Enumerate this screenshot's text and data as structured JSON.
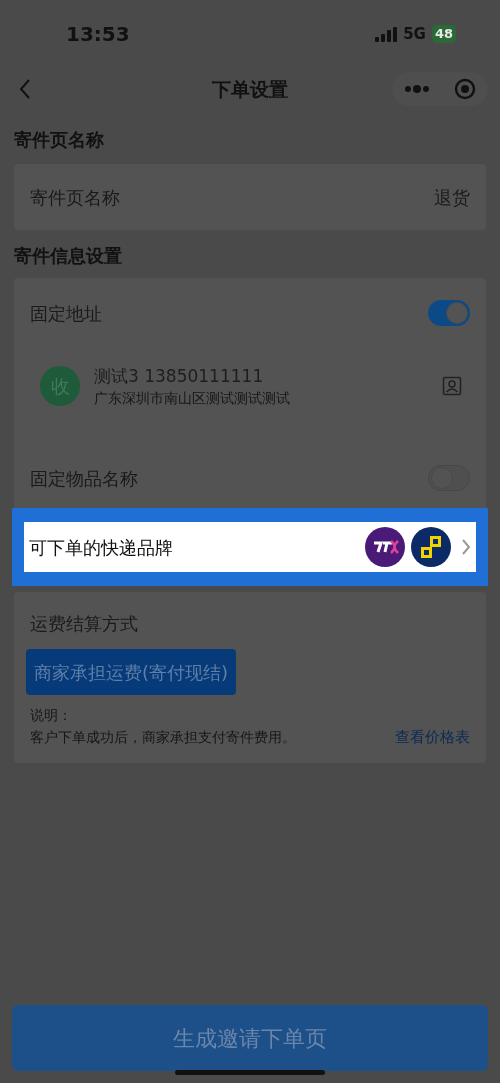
{
  "status_bar": {
    "time": "13:53",
    "network": "5G",
    "battery": "48"
  },
  "nav": {
    "title": "下单设置"
  },
  "page_name_section": {
    "title": "寄件页名称",
    "row": {
      "label": "寄件页名称",
      "value": "退货"
    }
  },
  "sender_info_section": {
    "title": "寄件信息设置",
    "fixed_address": {
      "label": "固定地址",
      "on": true
    },
    "contact": {
      "badge": "收",
      "name_phone": "测试3 13850111111",
      "address": "广东深圳市南山区测试测试测试"
    },
    "fixed_item_name": {
      "label": "固定物品名称",
      "on": false
    },
    "brand_row": {
      "label": "可下单的快递品牌",
      "highlighted": true
    }
  },
  "freight_section": {
    "title": "运费结算方式",
    "option": {
      "label": "商家承担运费(寄付现结)",
      "selected": true
    },
    "note_label": "说明：",
    "note_text": "客户下单成功后，商家承担支付寄件费用。",
    "price_link": "查看价格表"
  },
  "submit_button": {
    "label": "生成邀请下单页"
  }
}
